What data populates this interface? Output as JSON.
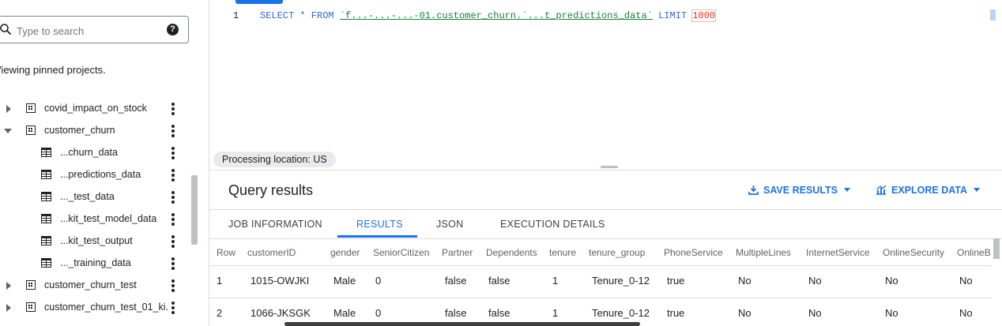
{
  "search": {
    "placeholder": "Type to search",
    "help": "?"
  },
  "explorer": {
    "pinned_text": "Viewing pinned projects.",
    "items": [
      {
        "label": "covid_impact_on_stock",
        "kind": "dataset",
        "state": "collapsed"
      },
      {
        "label": "customer_churn",
        "kind": "dataset",
        "state": "expanded"
      },
      {
        "label": "...churn_data",
        "kind": "table"
      },
      {
        "label": "...predictions_data",
        "kind": "table"
      },
      {
        "label": "..._test_data",
        "kind": "table"
      },
      {
        "label": "...kit_test_model_data",
        "kind": "table"
      },
      {
        "label": "...kit_test_output",
        "kind": "table"
      },
      {
        "label": "..._training_data",
        "kind": "table"
      },
      {
        "label": "customer_churn_test",
        "kind": "dataset",
        "state": "collapsed"
      },
      {
        "label": "customer_churn_test_01_ki...",
        "kind": "dataset",
        "state": "collapsed"
      }
    ]
  },
  "editor": {
    "line_number": "1",
    "kw_select": "SELECT * FROM ",
    "table_ref": "`f...-...-...-01.customer_churn.`...t_predictions_data`",
    "kw_limit": " LIMIT ",
    "limit_value": "1000"
  },
  "processing_location": "Processing location: US",
  "results": {
    "title": "Query results",
    "save_label": "SAVE RESULTS",
    "explore_label": "EXPLORE DATA",
    "tabs": [
      "JOB INFORMATION",
      "RESULTS",
      "JSON",
      "EXECUTION DETAILS"
    ],
    "active_tab": "RESULTS",
    "columns": [
      "Row",
      "customerID",
      "gender",
      "SeniorCitizen",
      "Partner",
      "Dependents",
      "tenure",
      "tenure_group",
      "PhoneService",
      "MultipleLines",
      "InternetService",
      "OnlineSecurity",
      "OnlineB"
    ],
    "rows": [
      [
        "1",
        "1015-OWJKI",
        "Male",
        "0",
        "false",
        "false",
        "1",
        "Tenure_0-12",
        "true",
        "No",
        "No",
        "No",
        "No"
      ],
      [
        "2",
        "1066-JKSGK",
        "Male",
        "0",
        "false",
        "false",
        "1",
        "Tenure_0-12",
        "true",
        "No",
        "No",
        "No",
        "No"
      ]
    ]
  },
  "colors": {
    "accent": "#1a73e8",
    "keyword": "#3367d6",
    "table_ref": "#188038",
    "number": "#d93025"
  }
}
